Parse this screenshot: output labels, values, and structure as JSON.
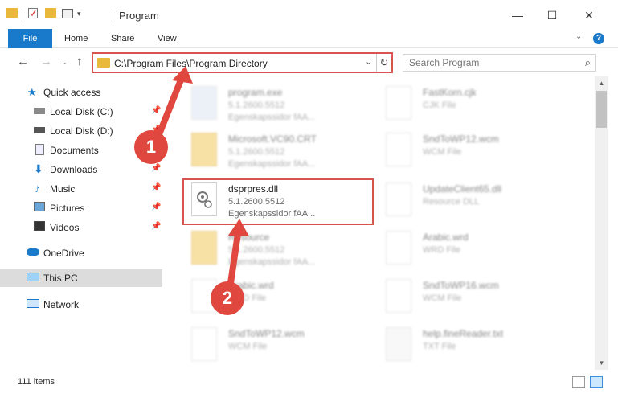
{
  "window": {
    "title": "Program",
    "minimize": "—",
    "maximize": "☐",
    "close": "✕"
  },
  "ribbon": {
    "tabs": [
      "File",
      "Home",
      "Share",
      "View"
    ],
    "help": "?"
  },
  "address": {
    "path": "C:\\Program Files\\Program Directory",
    "refresh": "↻"
  },
  "search": {
    "placeholder": "Search Program"
  },
  "sidebar": {
    "items": [
      {
        "label": "Quick access",
        "icon": "star-icon",
        "pinned": false
      },
      {
        "label": "Local Disk (C:)",
        "icon": "drive-icon",
        "pinned": true
      },
      {
        "label": "Local Disk (D:)",
        "icon": "drive-icon",
        "pinned": true
      },
      {
        "label": "Documents",
        "icon": "documents-icon",
        "pinned": true
      },
      {
        "label": "Downloads",
        "icon": "download-icon",
        "pinned": true
      },
      {
        "label": "Music",
        "icon": "music-icon",
        "pinned": true
      },
      {
        "label": "Pictures",
        "icon": "pictures-icon",
        "pinned": true
      },
      {
        "label": "Videos",
        "icon": "videos-icon",
        "pinned": true
      },
      {
        "label": "OneDrive",
        "icon": "cloud-icon",
        "pinned": false
      },
      {
        "label": "This PC",
        "icon": "computer-icon",
        "pinned": false,
        "selected": true
      },
      {
        "label": "Network",
        "icon": "network-icon",
        "pinned": false
      }
    ]
  },
  "files": [
    {
      "name": "program.exe",
      "line2": "5.1.2600.5512",
      "line3": "Egenskapssidor fAA...",
      "kind": "exe"
    },
    {
      "name": "FastKorn.cjk",
      "line2": "CJK File",
      "line3": "",
      "kind": "doc"
    },
    {
      "name": "Microsoft.VC90.CRT",
      "line2": "5.1.2600.5512",
      "line3": "Egenskapssidor fAA...",
      "kind": "folder"
    },
    {
      "name": "SndToWP12.wcm",
      "line2": "WCM File",
      "line3": "",
      "kind": "doc"
    },
    {
      "name": "dsprpres.dll",
      "line2": "5.1.2600.5512",
      "line3": "Egenskapssidor fAA...",
      "kind": "dll"
    },
    {
      "name": "UpdateClient65.dll",
      "line2": "Resource DLL",
      "line3": "",
      "kind": "dll"
    },
    {
      "name": "Resource",
      "line2": "5.1.2600.5512",
      "line3": "Egenskapssidor fAA...",
      "kind": "folder"
    },
    {
      "name": "Arabic.wrd",
      "line2": "WRD File",
      "line3": "",
      "kind": "doc"
    },
    {
      "name": "Arabic.wrd",
      "line2": "WRD File",
      "line3": "",
      "kind": "doc"
    },
    {
      "name": "SndToWP16.wcm",
      "line2": "WCM File",
      "line3": "",
      "kind": "doc"
    },
    {
      "name": "SndToWP12.wcm",
      "line2": "WCM File",
      "line3": "",
      "kind": "doc"
    },
    {
      "name": "help.fineReader.txt",
      "line2": "TXT File",
      "line3": "",
      "kind": "doc"
    }
  ],
  "status": {
    "count": "111 items"
  },
  "callouts": [
    "1",
    "2"
  ],
  "colors": {
    "accent": "#1979ca",
    "callout": "#e0473e"
  }
}
